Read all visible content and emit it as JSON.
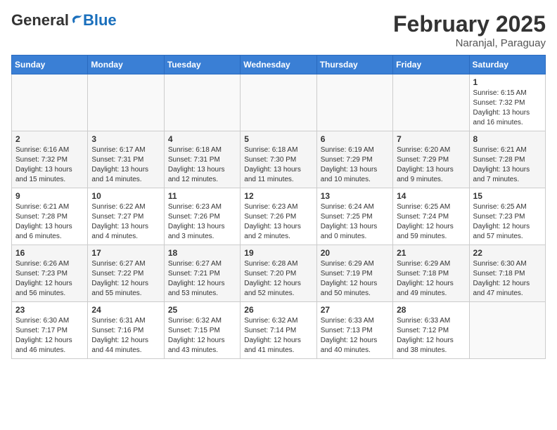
{
  "header": {
    "logo_general": "General",
    "logo_blue": "Blue",
    "month_title": "February 2025",
    "location": "Naranjal, Paraguay"
  },
  "weekdays": [
    "Sunday",
    "Monday",
    "Tuesday",
    "Wednesday",
    "Thursday",
    "Friday",
    "Saturday"
  ],
  "weeks": [
    [
      {
        "day": "",
        "info": ""
      },
      {
        "day": "",
        "info": ""
      },
      {
        "day": "",
        "info": ""
      },
      {
        "day": "",
        "info": ""
      },
      {
        "day": "",
        "info": ""
      },
      {
        "day": "",
        "info": ""
      },
      {
        "day": "1",
        "info": "Sunrise: 6:15 AM\nSunset: 7:32 PM\nDaylight: 13 hours\nand 16 minutes."
      }
    ],
    [
      {
        "day": "2",
        "info": "Sunrise: 6:16 AM\nSunset: 7:32 PM\nDaylight: 13 hours\nand 15 minutes."
      },
      {
        "day": "3",
        "info": "Sunrise: 6:17 AM\nSunset: 7:31 PM\nDaylight: 13 hours\nand 14 minutes."
      },
      {
        "day": "4",
        "info": "Sunrise: 6:18 AM\nSunset: 7:31 PM\nDaylight: 13 hours\nand 12 minutes."
      },
      {
        "day": "5",
        "info": "Sunrise: 6:18 AM\nSunset: 7:30 PM\nDaylight: 13 hours\nand 11 minutes."
      },
      {
        "day": "6",
        "info": "Sunrise: 6:19 AM\nSunset: 7:29 PM\nDaylight: 13 hours\nand 10 minutes."
      },
      {
        "day": "7",
        "info": "Sunrise: 6:20 AM\nSunset: 7:29 PM\nDaylight: 13 hours\nand 9 minutes."
      },
      {
        "day": "8",
        "info": "Sunrise: 6:21 AM\nSunset: 7:28 PM\nDaylight: 13 hours\nand 7 minutes."
      }
    ],
    [
      {
        "day": "9",
        "info": "Sunrise: 6:21 AM\nSunset: 7:28 PM\nDaylight: 13 hours\nand 6 minutes."
      },
      {
        "day": "10",
        "info": "Sunrise: 6:22 AM\nSunset: 7:27 PM\nDaylight: 13 hours\nand 4 minutes."
      },
      {
        "day": "11",
        "info": "Sunrise: 6:23 AM\nSunset: 7:26 PM\nDaylight: 13 hours\nand 3 minutes."
      },
      {
        "day": "12",
        "info": "Sunrise: 6:23 AM\nSunset: 7:26 PM\nDaylight: 13 hours\nand 2 minutes."
      },
      {
        "day": "13",
        "info": "Sunrise: 6:24 AM\nSunset: 7:25 PM\nDaylight: 13 hours\nand 0 minutes."
      },
      {
        "day": "14",
        "info": "Sunrise: 6:25 AM\nSunset: 7:24 PM\nDaylight: 12 hours\nand 59 minutes."
      },
      {
        "day": "15",
        "info": "Sunrise: 6:25 AM\nSunset: 7:23 PM\nDaylight: 12 hours\nand 57 minutes."
      }
    ],
    [
      {
        "day": "16",
        "info": "Sunrise: 6:26 AM\nSunset: 7:23 PM\nDaylight: 12 hours\nand 56 minutes."
      },
      {
        "day": "17",
        "info": "Sunrise: 6:27 AM\nSunset: 7:22 PM\nDaylight: 12 hours\nand 55 minutes."
      },
      {
        "day": "18",
        "info": "Sunrise: 6:27 AM\nSunset: 7:21 PM\nDaylight: 12 hours\nand 53 minutes."
      },
      {
        "day": "19",
        "info": "Sunrise: 6:28 AM\nSunset: 7:20 PM\nDaylight: 12 hours\nand 52 minutes."
      },
      {
        "day": "20",
        "info": "Sunrise: 6:29 AM\nSunset: 7:19 PM\nDaylight: 12 hours\nand 50 minutes."
      },
      {
        "day": "21",
        "info": "Sunrise: 6:29 AM\nSunset: 7:18 PM\nDaylight: 12 hours\nand 49 minutes."
      },
      {
        "day": "22",
        "info": "Sunrise: 6:30 AM\nSunset: 7:18 PM\nDaylight: 12 hours\nand 47 minutes."
      }
    ],
    [
      {
        "day": "23",
        "info": "Sunrise: 6:30 AM\nSunset: 7:17 PM\nDaylight: 12 hours\nand 46 minutes."
      },
      {
        "day": "24",
        "info": "Sunrise: 6:31 AM\nSunset: 7:16 PM\nDaylight: 12 hours\nand 44 minutes."
      },
      {
        "day": "25",
        "info": "Sunrise: 6:32 AM\nSunset: 7:15 PM\nDaylight: 12 hours\nand 43 minutes."
      },
      {
        "day": "26",
        "info": "Sunrise: 6:32 AM\nSunset: 7:14 PM\nDaylight: 12 hours\nand 41 minutes."
      },
      {
        "day": "27",
        "info": "Sunrise: 6:33 AM\nSunset: 7:13 PM\nDaylight: 12 hours\nand 40 minutes."
      },
      {
        "day": "28",
        "info": "Sunrise: 6:33 AM\nSunset: 7:12 PM\nDaylight: 12 hours\nand 38 minutes."
      },
      {
        "day": "",
        "info": ""
      }
    ]
  ]
}
